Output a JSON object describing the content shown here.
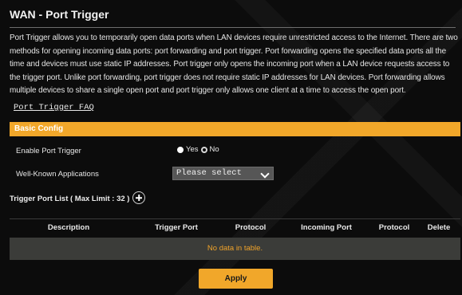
{
  "page": {
    "title": "WAN - Port Trigger",
    "description": "Port Trigger allows you to temporarily open data ports when LAN devices require unrestricted access to the Internet. There are two methods for opening incoming data ports: port forwarding and port trigger. Port forwarding opens the specified data ports all the time and devices must use static IP addresses. Port trigger only opens the incoming port when a LAN device requests access to the trigger port. Unlike port forwarding, port trigger does not require static IP addresses for LAN devices. Port forwarding allows multiple devices to share a single open port and port trigger only allows one client at a time to access the open port.",
    "faq_link": "Port Trigger FAQ"
  },
  "basic_config": {
    "header": "Basic Config",
    "enable_label": "Enable Port Trigger",
    "enable_options": [
      {
        "label": "Yes",
        "selected": true
      },
      {
        "label": "No",
        "selected": false
      }
    ],
    "apps_label": "Well-Known Applications",
    "apps_select_value": "Please select"
  },
  "trigger_list": {
    "title": "Trigger Port List ( Max Limit : 32 )",
    "columns": [
      "Description",
      "Trigger Port",
      "Protocol",
      "Incoming Port",
      "Protocol",
      "Delete"
    ],
    "empty_text": "No data in table."
  },
  "actions": {
    "apply_label": "Apply"
  },
  "colors": {
    "accent": "#f1a72a",
    "background": "#0c0c0c",
    "empty_row": "#3b3c39"
  }
}
